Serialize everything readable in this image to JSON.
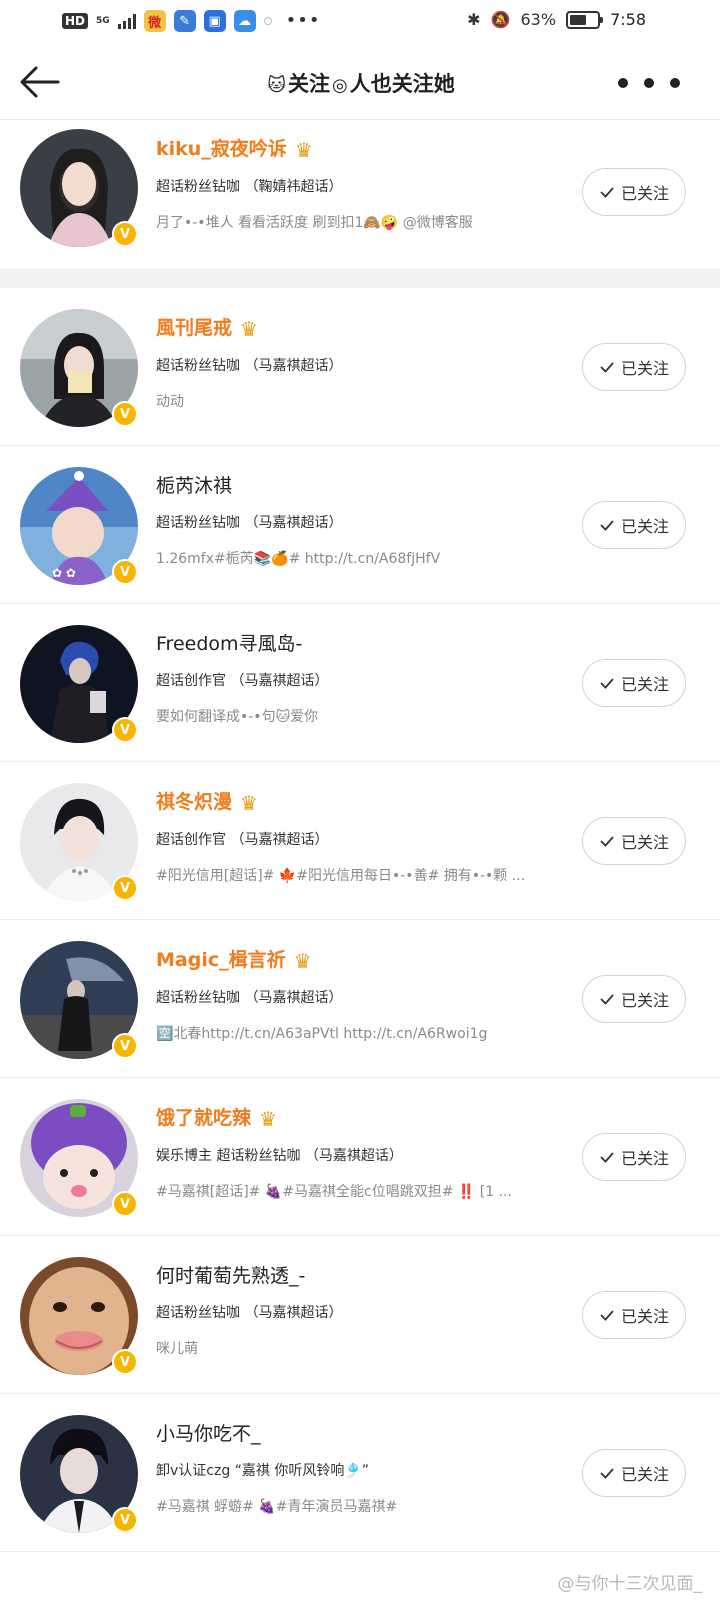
{
  "status_bar": {
    "left": {
      "hd": "HD",
      "network": "5G"
    },
    "app_icons": [
      "weibo-icon",
      "feather-icon",
      "contacts-icon",
      "cloud-icon"
    ],
    "right": {
      "battery": "63%",
      "time": "7:58"
    }
  },
  "nav": {
    "title_prefix": "关注",
    "title_suffix": "人也关注她"
  },
  "users": [
    {
      "name": "kiku_寂夜吟诉",
      "name_style": "orange",
      "crown": true,
      "desc": "超话粉丝钻咖 （鞠婧祎超话）",
      "extra": "月了•-•堆人  看看活跃度  刷到扣1🙈🤪  @微博客服",
      "button": "已关注"
    },
    {
      "name": "風刊尾戒",
      "name_style": "orange",
      "crown": true,
      "desc": "超话粉丝钻咖 （马嘉祺超话）",
      "extra": "动动",
      "button": "已关注"
    },
    {
      "name": "栀芮沐祺",
      "name_style": "black",
      "crown": false,
      "desc": "超话粉丝钻咖 （马嘉祺超话）",
      "extra": "1.26mfx#栀芮📚🍊#   http://t.cn/A68fjHfV",
      "button": "已关注"
    },
    {
      "name": "Freedom寻風岛-",
      "name_style": "black",
      "crown": false,
      "desc": "超话创作官 （马嘉祺超话）",
      "extra": "要如何翻译成•-•句🐱爱你",
      "button": "已关注"
    },
    {
      "name": "祺冬炽漫",
      "name_style": "orange",
      "crown": true,
      "desc": "超话创作官 （马嘉祺超话）",
      "extra": "#阳光信用[超话]#  🍁#阳光信用每日•-•善#     拥有•-•颗 ...",
      "button": "已关注"
    },
    {
      "name": "Magic_楫言祈",
      "name_style": "orange",
      "crown": true,
      "desc": "超话粉丝钻咖 （马嘉祺超话）",
      "extra": "🈳北春http://t.cn/A63aPVtl    http://t.cn/A6Rwoi1g",
      "button": "已关注"
    },
    {
      "name": "饿了就吃辣",
      "name_style": "orange",
      "crown": true,
      "desc": "娱乐博主  超话粉丝钻咖 （马嘉祺超话）",
      "extra": "#马嘉祺[超话]#  🍇#马嘉祺全能c位唱跳双担#    ‼️  [1 ...",
      "button": "已关注"
    },
    {
      "name": "何时葡萄先熟透_-",
      "name_style": "black",
      "crown": false,
      "desc": "超话粉丝钻咖 （马嘉祺超话）",
      "extra": "咪儿萌",
      "button": "已关注"
    },
    {
      "name": "小马你吃不_",
      "name_style": "black",
      "crown": false,
      "desc": "卸v认证czg  “嘉祺  你听风铃响🎐”",
      "extra": "#马嘉祺  蜉蝣#  🍇#青年演员马嘉祺#",
      "button": "已关注"
    }
  ],
  "watermark": "@与你十三次见面_"
}
